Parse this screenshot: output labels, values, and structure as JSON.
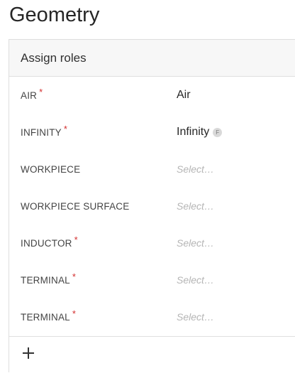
{
  "page": {
    "title": "Geometry"
  },
  "card": {
    "title": "Assign roles",
    "rows": [
      {
        "label": "AIR",
        "required": true,
        "value": "Air",
        "badge": ""
      },
      {
        "label": "INFINITY",
        "required": true,
        "value": "Infinity",
        "badge": "F"
      },
      {
        "label": "WORKPIECE",
        "required": false,
        "value": "Select…",
        "badge": ""
      },
      {
        "label": "WORKPIECE SURFACE",
        "required": false,
        "value": "Select…",
        "badge": ""
      },
      {
        "label": "INDUCTOR",
        "required": true,
        "value": "Select…",
        "badge": ""
      },
      {
        "label": "TERMINAL",
        "required": true,
        "value": "Select…",
        "badge": ""
      },
      {
        "label": "TERMINAL",
        "required": true,
        "value": "Select…",
        "badge": ""
      }
    ],
    "required_marker": "*",
    "footer": {
      "add_icon": "plus-icon"
    }
  },
  "colors": {
    "required": "#d32f2f",
    "placeholder": "#b5b5b5",
    "header_bg": "#f7f7f7"
  }
}
